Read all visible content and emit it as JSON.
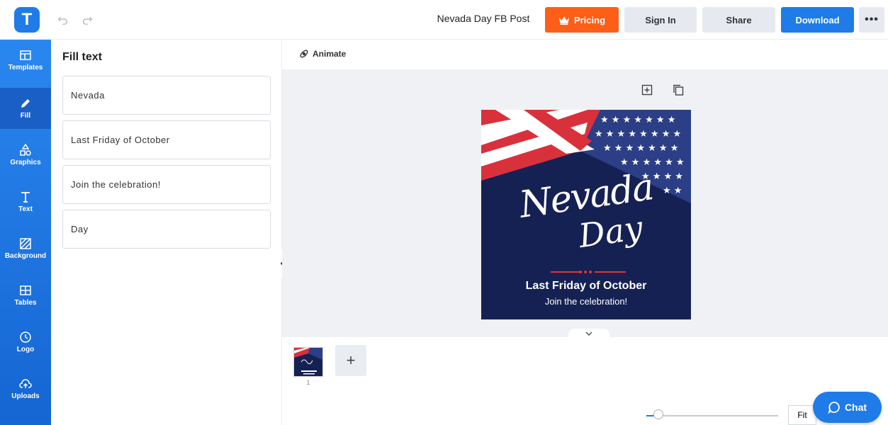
{
  "app": {
    "logo_letter": "T",
    "accent": "#1f7be8",
    "pricing_color": "#fd5e18"
  },
  "header": {
    "doc_title": "Nevada Day FB Post",
    "pricing_label": "Pricing",
    "signin_label": "Sign In",
    "share_label": "Share",
    "download_label": "Download",
    "more_label": "•••"
  },
  "sidebar": {
    "items": [
      {
        "label": "Templates",
        "icon": "templates-icon"
      },
      {
        "label": "Fill",
        "icon": "pencil-icon"
      },
      {
        "label": "Graphics",
        "icon": "shapes-icon"
      },
      {
        "label": "Text",
        "icon": "text-icon"
      },
      {
        "label": "Background",
        "icon": "background-icon"
      },
      {
        "label": "Tables",
        "icon": "table-icon"
      },
      {
        "label": "Logo",
        "icon": "logo-icon"
      },
      {
        "label": "Uploads",
        "icon": "upload-cloud-icon"
      }
    ],
    "active": "Fill"
  },
  "panel": {
    "title": "Fill text",
    "fields": [
      "Nevada",
      "Last Friday of October",
      "Join the celebration!",
      "Day"
    ]
  },
  "editor": {
    "animate_label": "Animate",
    "design": {
      "script_title": "Nevada",
      "script_subtitle": "Day",
      "headline": "Last Friday of October",
      "tagline": "Join the celebration!"
    },
    "page_number": "1",
    "add_page_label": "+",
    "fit_label": "Fit",
    "zoom_level": 0.09
  },
  "chat": {
    "label": "Chat"
  }
}
